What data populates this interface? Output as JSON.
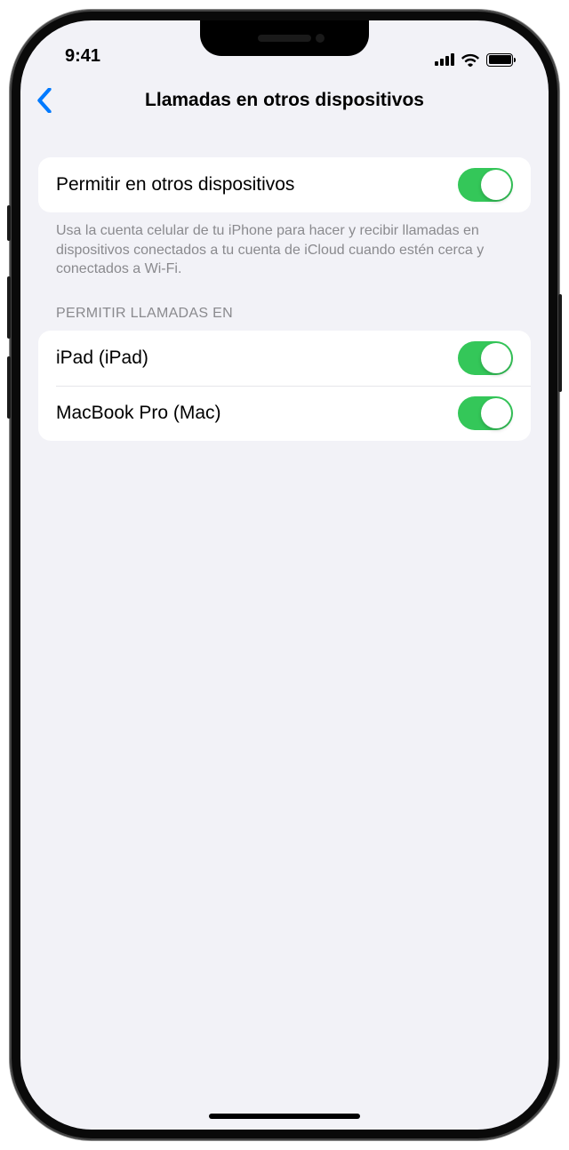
{
  "status": {
    "time": "9:41"
  },
  "nav": {
    "title": "Llamadas en otros dispositivos"
  },
  "main_toggle": {
    "label": "Permitir en otros dispositivos",
    "on": true,
    "description": "Usa la cuenta celular de tu iPhone para hacer y recibir llamadas en dispositivos conectados a tu cuenta de iCloud cuando estén cerca y conectados a Wi-Fi."
  },
  "devices_section": {
    "header": "PERMITIR LLAMADAS EN",
    "items": [
      {
        "label": "iPad (iPad)",
        "on": true
      },
      {
        "label": "MacBook Pro (Mac)",
        "on": true
      }
    ]
  }
}
